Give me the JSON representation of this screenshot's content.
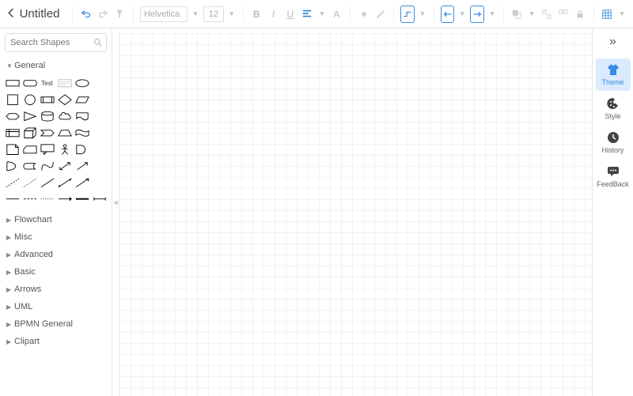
{
  "topbar": {
    "title": "Untitled",
    "font": "Helvetica",
    "size": "12"
  },
  "sidebar": {
    "search_placeholder": "Search Shapes",
    "categories": [
      {
        "label": "General",
        "open": true
      },
      {
        "label": "Flowchart",
        "open": false
      },
      {
        "label": "Misc",
        "open": false
      },
      {
        "label": "Advanced",
        "open": false
      },
      {
        "label": "Basic",
        "open": false
      },
      {
        "label": "Arrows",
        "open": false
      },
      {
        "label": "UML",
        "open": false
      },
      {
        "label": "BPMN General",
        "open": false
      },
      {
        "label": "Clipart",
        "open": false
      }
    ],
    "text_shape_label": "Text"
  },
  "rightpanel": {
    "items": [
      {
        "label": "Theme"
      },
      {
        "label": "Style"
      },
      {
        "label": "History"
      },
      {
        "label": "FeedBack"
      }
    ]
  }
}
